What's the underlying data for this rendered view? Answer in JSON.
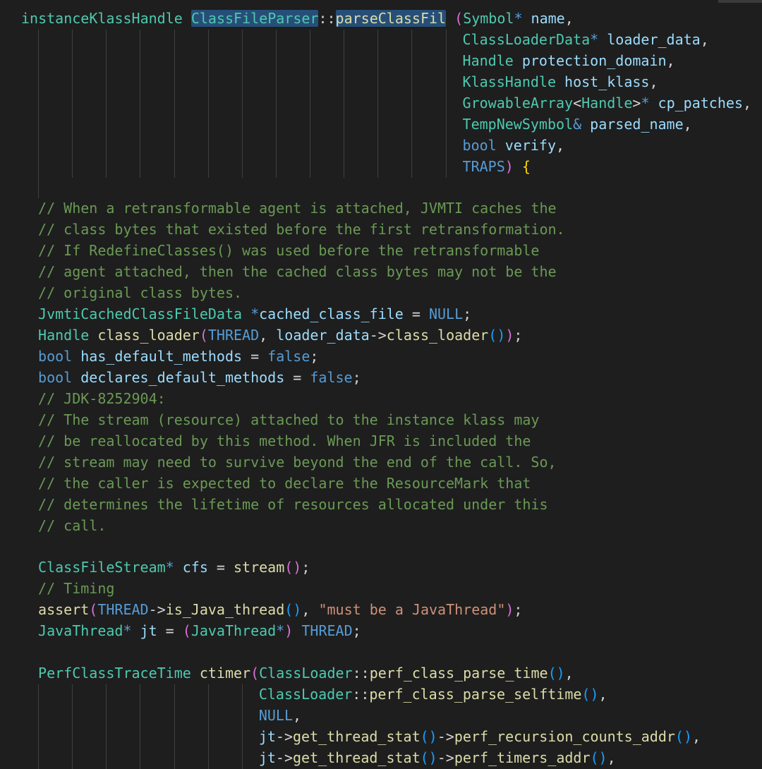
{
  "editor": {
    "language": "cpp",
    "colors": {
      "background": "#1e1e1e",
      "type": "#4ec9b0",
      "function": "#dcdcaa",
      "variable": "#9cdcfe",
      "keyword": "#569cd6",
      "comment": "#6a9955",
      "string": "#ce9178",
      "selection": "#264f78"
    },
    "lines": [
      {
        "tokens": [
          [
            "type",
            "instanceKlassHandle"
          ],
          [
            "punc",
            " "
          ],
          [
            "sel",
            "ClassFileParser"
          ],
          [
            "punc",
            "::"
          ],
          [
            "funcsel",
            "parseClassFil"
          ],
          [
            "punc",
            " "
          ],
          [
            "paren",
            "("
          ],
          [
            "type",
            "Symbol"
          ],
          [
            "kw",
            "*"
          ],
          [
            "var",
            " name"
          ],
          [
            "punc",
            ","
          ]
        ]
      },
      {
        "tokens": [
          [
            "type",
            "ClassLoaderData"
          ],
          [
            "kw",
            "*"
          ],
          [
            "var",
            " loader_data"
          ],
          [
            "punc",
            ","
          ]
        ]
      },
      {
        "tokens": [
          [
            "type",
            "Handle"
          ],
          [
            "var",
            " protection_domain"
          ],
          [
            "punc",
            ","
          ]
        ]
      },
      {
        "tokens": [
          [
            "type",
            "KlassHandle"
          ],
          [
            "var",
            " host_klass"
          ],
          [
            "punc",
            ","
          ]
        ]
      },
      {
        "tokens": [
          [
            "type",
            "GrowableArray"
          ],
          [
            "punc",
            "<"
          ],
          [
            "type",
            "Handle"
          ],
          [
            "punc",
            ">"
          ],
          [
            "kw",
            "*"
          ],
          [
            "var",
            " cp_patches"
          ],
          [
            "punc",
            ","
          ]
        ]
      },
      {
        "tokens": [
          [
            "type",
            "TempNewSymbol"
          ],
          [
            "kw",
            "&"
          ],
          [
            "var",
            " parsed_name"
          ],
          [
            "punc",
            ","
          ]
        ]
      },
      {
        "tokens": [
          [
            "kw",
            "bool"
          ],
          [
            "var",
            " verify"
          ],
          [
            "punc",
            ","
          ]
        ]
      },
      {
        "tokens": [
          [
            "kw",
            "TRAPS"
          ],
          [
            "paren",
            ")"
          ],
          [
            "punc",
            " "
          ],
          [
            "brace",
            "{"
          ]
        ]
      },
      {
        "tokens": []
      },
      {
        "tokens": [
          [
            "cmt",
            "// When a retransformable agent is attached, JVMTI caches the"
          ]
        ]
      },
      {
        "tokens": [
          [
            "cmt",
            "// class bytes that existed before the first retransformation."
          ]
        ]
      },
      {
        "tokens": [
          [
            "cmt",
            "// If RedefineClasses() was used before the retransformable"
          ]
        ]
      },
      {
        "tokens": [
          [
            "cmt",
            "// agent attached, then the cached class bytes may not be the"
          ]
        ]
      },
      {
        "tokens": [
          [
            "cmt",
            "// original class bytes."
          ]
        ]
      },
      {
        "tokens": [
          [
            "type",
            "JvmtiCachedClassFileData"
          ],
          [
            "punc",
            " "
          ],
          [
            "kw",
            "*"
          ],
          [
            "var",
            "cached_class_file"
          ],
          [
            "punc",
            " = "
          ],
          [
            "kw",
            "NULL"
          ],
          [
            "punc",
            ";"
          ]
        ]
      },
      {
        "tokens": [
          [
            "type",
            "Handle"
          ],
          [
            "punc",
            " "
          ],
          [
            "func",
            "class_loader"
          ],
          [
            "paren",
            "("
          ],
          [
            "kw",
            "THREAD"
          ],
          [
            "punc",
            ", "
          ],
          [
            "var",
            "loader_data"
          ],
          [
            "punc",
            "->"
          ],
          [
            "func",
            "class_loader"
          ],
          [
            "paren2",
            "()"
          ],
          [
            "paren",
            ")"
          ],
          [
            "punc",
            ";"
          ]
        ]
      },
      {
        "tokens": [
          [
            "kw",
            "bool"
          ],
          [
            "var",
            " has_default_methods"
          ],
          [
            "punc",
            " = "
          ],
          [
            "kw",
            "false"
          ],
          [
            "punc",
            ";"
          ]
        ]
      },
      {
        "tokens": [
          [
            "kw",
            "bool"
          ],
          [
            "var",
            " declares_default_methods"
          ],
          [
            "punc",
            " = "
          ],
          [
            "kw",
            "false"
          ],
          [
            "punc",
            ";"
          ]
        ]
      },
      {
        "tokens": [
          [
            "cmt",
            "// JDK-8252904:"
          ]
        ]
      },
      {
        "tokens": [
          [
            "cmt",
            "// The stream (resource) attached to the instance klass may"
          ]
        ]
      },
      {
        "tokens": [
          [
            "cmt",
            "// be reallocated by this method. When JFR is included the"
          ]
        ]
      },
      {
        "tokens": [
          [
            "cmt",
            "// stream may need to survive beyond the end of the call. So,"
          ]
        ]
      },
      {
        "tokens": [
          [
            "cmt",
            "// the caller is expected to declare the ResourceMark that"
          ]
        ]
      },
      {
        "tokens": [
          [
            "cmt",
            "// determines the lifetime of resources allocated under this"
          ]
        ]
      },
      {
        "tokens": [
          [
            "cmt",
            "// call."
          ]
        ]
      },
      {
        "tokens": []
      },
      {
        "tokens": [
          [
            "type",
            "ClassFileStream"
          ],
          [
            "kw",
            "*"
          ],
          [
            "var",
            " cfs"
          ],
          [
            "punc",
            " = "
          ],
          [
            "func",
            "stream"
          ],
          [
            "paren",
            "()"
          ],
          [
            "punc",
            ";"
          ]
        ]
      },
      {
        "tokens": [
          [
            "cmt",
            "// Timing"
          ]
        ]
      },
      {
        "tokens": [
          [
            "func",
            "assert"
          ],
          [
            "paren",
            "("
          ],
          [
            "kw",
            "THREAD"
          ],
          [
            "punc",
            "->"
          ],
          [
            "func",
            "is_Java_thread"
          ],
          [
            "paren2",
            "()"
          ],
          [
            "punc",
            ", "
          ],
          [
            "str",
            "\"must be a JavaThread\""
          ],
          [
            "paren",
            ")"
          ],
          [
            "punc",
            ";"
          ]
        ]
      },
      {
        "tokens": [
          [
            "type",
            "JavaThread"
          ],
          [
            "kw",
            "*"
          ],
          [
            "var",
            " jt"
          ],
          [
            "punc",
            " = "
          ],
          [
            "paren",
            "("
          ],
          [
            "type",
            "JavaThread"
          ],
          [
            "kw",
            "*"
          ],
          [
            "paren",
            ")"
          ],
          [
            "punc",
            " "
          ],
          [
            "kw",
            "THREAD"
          ],
          [
            "punc",
            ";"
          ]
        ]
      },
      {
        "tokens": []
      },
      {
        "tokens": [
          [
            "type",
            "PerfClassTraceTime"
          ],
          [
            "punc",
            " "
          ],
          [
            "func",
            "ctimer"
          ],
          [
            "paren",
            "("
          ],
          [
            "type",
            "ClassLoader"
          ],
          [
            "punc",
            "::"
          ],
          [
            "func",
            "perf_class_parse_time"
          ],
          [
            "paren2",
            "()"
          ],
          [
            "punc",
            ","
          ]
        ]
      },
      {
        "tokens": [
          [
            "type",
            "ClassLoader"
          ],
          [
            "punc",
            "::"
          ],
          [
            "func",
            "perf_class_parse_selftime"
          ],
          [
            "paren2",
            "()"
          ],
          [
            "punc",
            ","
          ]
        ]
      },
      {
        "tokens": [
          [
            "kw",
            "NULL"
          ],
          [
            "punc",
            ","
          ]
        ]
      },
      {
        "tokens": [
          [
            "var",
            "jt"
          ],
          [
            "punc",
            "->"
          ],
          [
            "func",
            "get_thread_stat"
          ],
          [
            "paren2",
            "()"
          ],
          [
            "punc",
            "->"
          ],
          [
            "func",
            "perf_recursion_counts_addr"
          ],
          [
            "paren2",
            "()"
          ],
          [
            "punc",
            ","
          ]
        ]
      },
      {
        "tokens": [
          [
            "var",
            "jt"
          ],
          [
            "punc",
            "->"
          ],
          [
            "func",
            "get_thread_stat"
          ],
          [
            "paren2",
            "()"
          ],
          [
            "punc",
            "->"
          ],
          [
            "func",
            "perf_timers_addr"
          ],
          [
            "paren2",
            "()"
          ],
          [
            "punc",
            ","
          ]
        ]
      }
    ]
  }
}
